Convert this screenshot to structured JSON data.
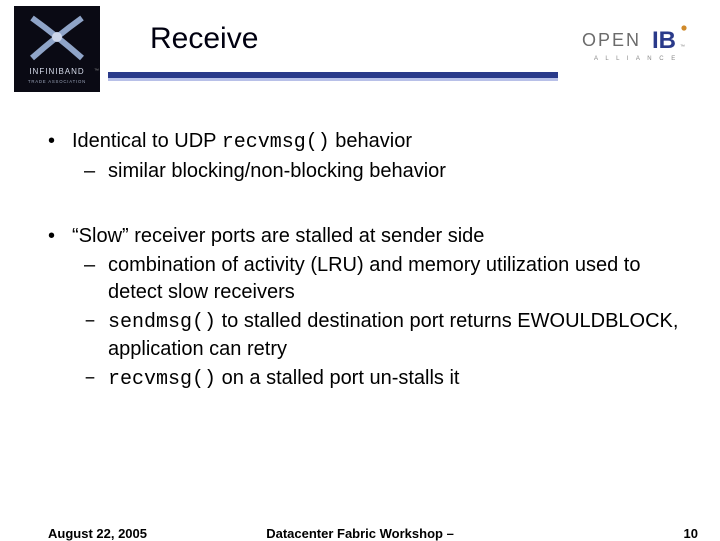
{
  "header": {
    "title": "Receive",
    "logo_left_name": "infiniband-trade-association-logo",
    "logo_right_name": "open-ib-alliance-logo",
    "logo_left_text1": "INFINIBAND",
    "logo_left_text2": "TRADE ASSOCIATION",
    "logo_right_open": "OPEN",
    "logo_right_ib": "IB",
    "logo_right_sub": "A L L I A N C E"
  },
  "bullets": [
    {
      "pre": "Identical to UDP ",
      "code": "recvmsg()",
      "post": " behavior",
      "subs": [
        {
          "text": "similar blocking/non-blocking behavior"
        }
      ]
    },
    {
      "pre": "“Slow” receiver ports are stalled at sender side",
      "code": "",
      "post": "",
      "subs": [
        {
          "text": "combination of activity (LRU) and memory utilization used to detect slow receivers"
        },
        {
          "code": "sendmsg()",
          "post": " to stalled destination port returns EWOULDBLOCK, application can retry"
        },
        {
          "code": "recvmsg()",
          "post": " on a stalled port un-stalls it"
        }
      ]
    }
  ],
  "footer": {
    "date": "August 22, 2005",
    "center": "Datacenter Fabric Workshop –",
    "page": "10"
  }
}
